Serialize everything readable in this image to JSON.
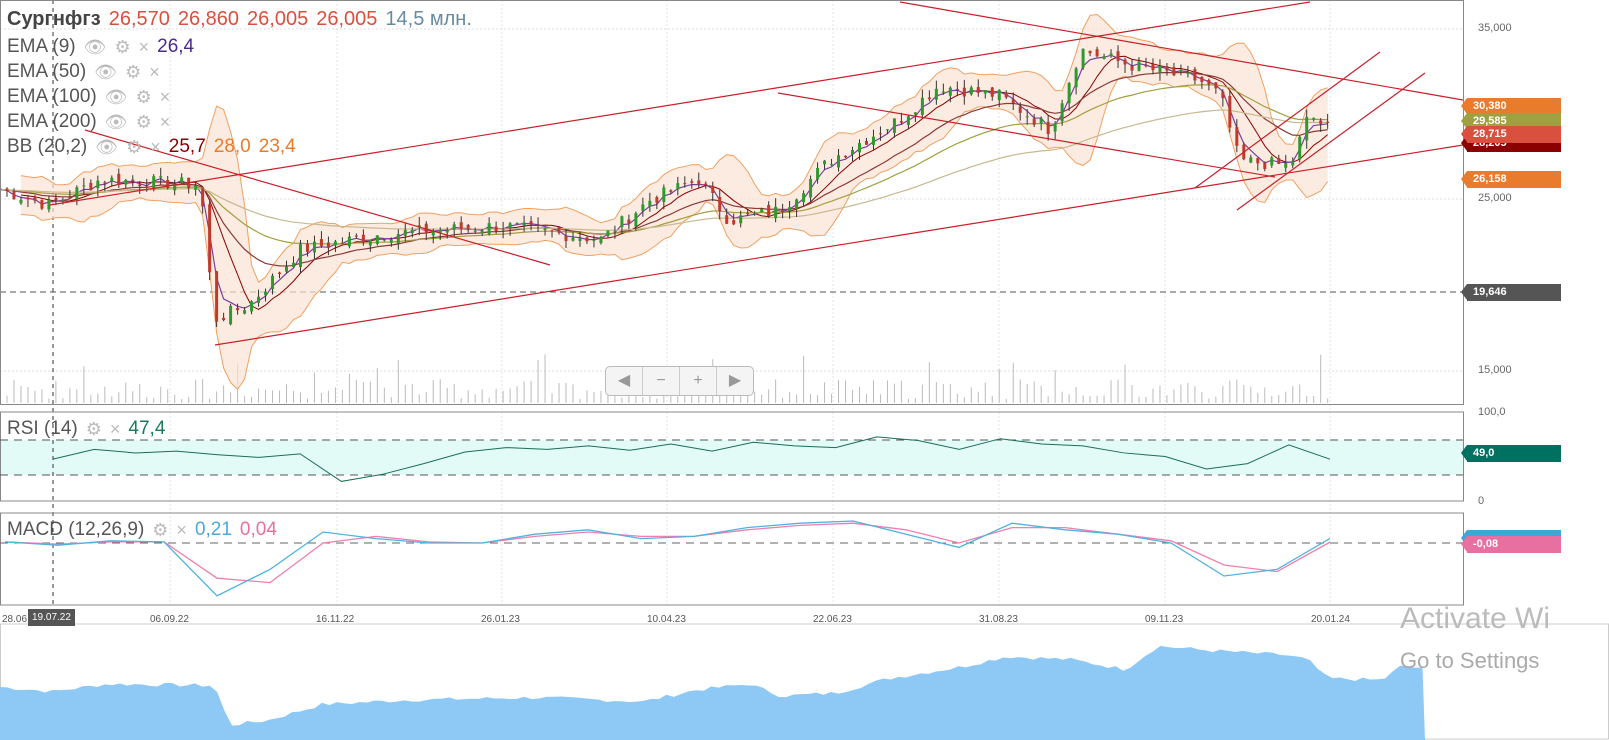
{
  "header": {
    "symbol": "Сургнфгз",
    "open": "26,570",
    "high": "26,860",
    "low": "26,005",
    "close": "26,005",
    "volume": "14,5 млн."
  },
  "indicators": [
    {
      "label": "EMA (9)",
      "value": "26,4",
      "color": "#4b2a8f"
    },
    {
      "label": "EMA (50)",
      "value": null
    },
    {
      "label": "EMA (100)",
      "value": null
    },
    {
      "label": "EMA (200)",
      "value": null
    },
    {
      "label": "BB (20,2)",
      "values": [
        "25,7",
        "28,0",
        "23,4"
      ]
    }
  ],
  "rsi": {
    "label": "RSI (14)",
    "value": "47,4",
    "axis": [
      "100,0",
      "0"
    ],
    "tag": "49,0"
  },
  "macd": {
    "label": "MACD (12,26,9)",
    "macd": "0,21",
    "signal": "0,04",
    "tag": "-0,08"
  },
  "price_axis": [
    "35,000",
    "25,000",
    "15,000"
  ],
  "price_tags": [
    {
      "text": "30,380",
      "color": "#e87b2c"
    },
    {
      "text": "29,585",
      "color": "#a0a040"
    },
    {
      "text": "28,205",
      "color": "#8b0000"
    },
    {
      "text": "28,715",
      "color": "#d9503f"
    },
    {
      "text": "26,158",
      "color": "#e87b2c"
    },
    {
      "text": "19,646",
      "color": "#555555"
    }
  ],
  "x_axis": [
    "28.06",
    "19.07.22",
    "06.09.22",
    "16.11.22",
    "26.01.23",
    "10.04.23",
    "22.06.23",
    "31.08.23",
    "09.11.23",
    "20.01.24"
  ],
  "zoom_controls": [
    "◀",
    "−",
    "+",
    "▶"
  ],
  "watermark": {
    "line1": "Activate Wi",
    "line2": "Go to Settings"
  },
  "chart_data": {
    "type": "candlestick",
    "title": "Сургнфгз",
    "x_unit": "days since 28.06.22",
    "keypoints": [
      [
        0,
        25.6
      ],
      [
        21,
        24.7
      ],
      [
        43,
        26.2
      ],
      [
        86,
        25.9
      ],
      [
        92,
        18.0
      ],
      [
        107,
        18.9
      ],
      [
        129,
        22.1
      ],
      [
        163,
        23.0
      ],
      [
        215,
        23.5
      ],
      [
        258,
        22.7
      ],
      [
        279,
        25.0
      ],
      [
        300,
        26.2
      ],
      [
        313,
        23.8
      ],
      [
        335,
        24.4
      ],
      [
        356,
        27.3
      ],
      [
        386,
        29.7
      ],
      [
        403,
        31.7
      ],
      [
        429,
        31.1
      ],
      [
        451,
        29.1
      ],
      [
        464,
        33.8
      ],
      [
        485,
        32.9
      ],
      [
        515,
        32.0
      ],
      [
        524,
        31.1
      ],
      [
        532,
        27.3
      ],
      [
        554,
        27.0
      ],
      [
        562,
        30.0
      ],
      [
        571,
        29.1
      ]
    ],
    "ylim": [
      13,
      36
    ],
    "rsi": [
      47,
      58,
      54,
      56,
      52,
      49,
      53,
      22,
      30,
      42,
      55,
      60,
      58,
      62,
      57,
      64,
      56,
      66,
      62,
      60,
      72,
      68,
      58,
      70,
      64,
      62,
      54,
      50,
      36,
      42,
      63,
      47
    ],
    "macd": [
      0.05,
      -0.1,
      0.1,
      0.05,
      -2.4,
      -1.2,
      0.5,
      0.2,
      0.0,
      0.0,
      0.4,
      0.6,
      0.2,
      0.3,
      0.7,
      0.9,
      1.0,
      0.4,
      -0.2,
      0.9,
      0.6,
      0.4,
      0.0,
      -1.5,
      -1.2,
      0.21
    ],
    "signal": [
      0.05,
      -0.05,
      0.05,
      0.05,
      -1.6,
      -1.8,
      0.0,
      0.3,
      0.05,
      0.0,
      0.3,
      0.5,
      0.3,
      0.3,
      0.6,
      0.8,
      0.9,
      0.6,
      0.0,
      0.7,
      0.7,
      0.4,
      0.1,
      -1.0,
      -1.3,
      0.04
    ]
  }
}
